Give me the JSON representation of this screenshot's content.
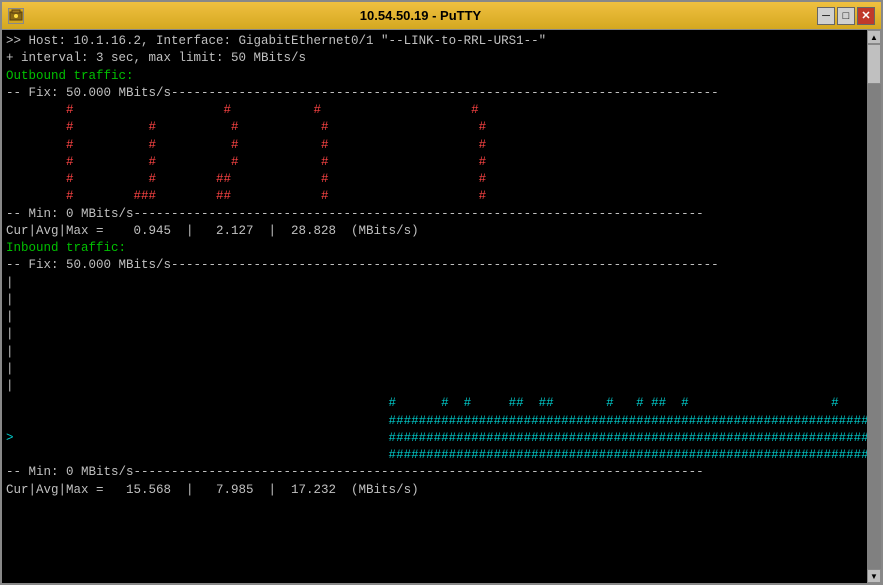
{
  "window": {
    "title": "10.54.50.19 - PuTTY",
    "minimize_label": "─",
    "maximize_label": "□",
    "close_label": "✕"
  },
  "terminal": {
    "lines": [
      {
        "text": ">> Host: 10.1.16.2, Interface: GigabitEthernet0/1 \"--LINK-to-RRL-URS1--\"",
        "color": "white"
      },
      {
        "text": "+ interval: 3 sec, max limit: 50 MBits/s",
        "color": "white"
      },
      {
        "text": "",
        "color": "white"
      },
      {
        "text": "Outbound traffic:",
        "color": "green"
      },
      {
        "text": "-- Fix: 50.000 MBits/s-------------------------------------------------------------------------",
        "color": "white"
      },
      {
        "text": "",
        "color": "white"
      },
      {
        "text": "",
        "color": "white"
      },
      {
        "text": "",
        "color": "white"
      },
      {
        "text": "        #                    #           #                    #",
        "color": "red"
      },
      {
        "text": "        #          #          #           #                    #",
        "color": "red"
      },
      {
        "text": "        #          #          #           #                    #",
        "color": "red"
      },
      {
        "text": "        #          #          #           #                    #",
        "color": "red"
      },
      {
        "text": "        #          #        ##            #                    #",
        "color": "red"
      },
      {
        "text": "        #        ###        ##            #                    #",
        "color": "red"
      },
      {
        "text": "-- Min: 0 MBits/s----------------------------------------------------------------------------",
        "color": "white"
      },
      {
        "text": "Cur|Avg|Max =    0.945  |   2.127  |  28.828  (MBits/s)",
        "color": "white"
      },
      {
        "text": "",
        "color": "white"
      },
      {
        "text": "Inbound traffic:",
        "color": "green"
      },
      {
        "text": "-- Fix: 50.000 MBits/s-------------------------------------------------------------------------",
        "color": "white"
      },
      {
        "text": "|",
        "color": "white"
      },
      {
        "text": "|",
        "color": "white"
      },
      {
        "text": "|",
        "color": "white"
      },
      {
        "text": "|",
        "color": "white"
      },
      {
        "text": "|",
        "color": "white"
      },
      {
        "text": "|",
        "color": "white"
      },
      {
        "text": "|",
        "color": "white"
      },
      {
        "text": "                                                   #      #  #     ##  ##       #   # ##  #                   #",
        "color": "cyan"
      },
      {
        "text": "                                                   ############################################################################################################",
        "color": "cyan"
      },
      {
        "text": ">                                                  ############################################################################################################",
        "color": "cyan"
      },
      {
        "text": "                                                   ############################################################################################################",
        "color": "cyan"
      },
      {
        "text": "-- Min: 0 MBits/s----------------------------------------------------------------------------",
        "color": "white"
      },
      {
        "text": "Cur|Avg|Max =   15.568  |   7.985  |  17.232  (MBits/s)",
        "color": "white"
      }
    ]
  }
}
